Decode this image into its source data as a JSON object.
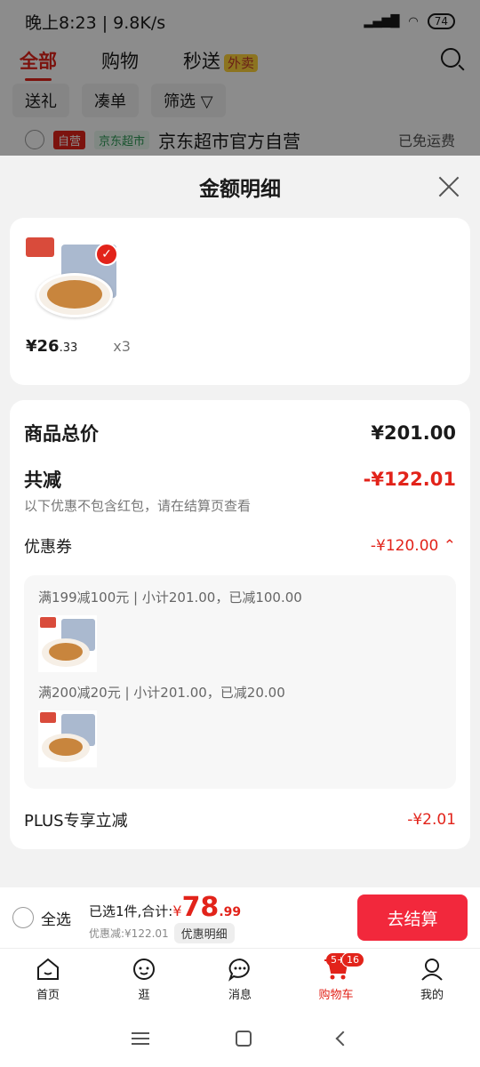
{
  "status_bar": {
    "time_speed": "晚上8:23 | 9.8K/s",
    "battery": "74"
  },
  "top_tabs": [
    {
      "label": "全部"
    },
    {
      "label": "购物"
    },
    {
      "label": "秒送",
      "badge": "外卖"
    }
  ],
  "chips": [
    "送礼",
    "凑单",
    "筛选"
  ],
  "store": {
    "tag_self": "自营",
    "tag_market": "京东超市",
    "name": "京东超市官方自营",
    "shipping": "已免运费"
  },
  "sheet": {
    "title": "金额明细",
    "product": {
      "price_int": "¥26",
      "price_dec": ".33",
      "qty": "x3"
    },
    "total_label": "商品总价",
    "total_value": "¥201.00",
    "reduce_label": "共减",
    "reduce_value": "-¥122.01",
    "reduce_note": "以下优惠不包含红包，请在结算页查看",
    "coupon_label": "优惠券",
    "coupon_value": "-¥120.00",
    "coupons": [
      {
        "text": "满199减100元 | 小计201.00，已减100.00"
      },
      {
        "text": "满200减20元 | 小计201.00，已减20.00"
      }
    ],
    "plus_label": "PLUS专享立减",
    "plus_value": "-¥2.01"
  },
  "checkout": {
    "select_all": "全选",
    "selected_text": "已选1件,合计:",
    "currency": "¥",
    "total_int": "78",
    "total_dec": ".99",
    "discount_text": "优惠减:¥122.01",
    "detail_btn": "优惠明细",
    "checkout_btn": "去结算"
  },
  "tabbar": [
    {
      "label": "首页",
      "icon": "home-icon"
    },
    {
      "label": "逛",
      "icon": "face-icon"
    },
    {
      "label": "消息",
      "icon": "message-icon",
      "badge": "5+"
    },
    {
      "label": "购物车",
      "icon": "cart-icon",
      "badge": "16",
      "active": true
    },
    {
      "label": "我的",
      "icon": "user-icon"
    }
  ],
  "colors": {
    "accent": "#e2231a",
    "checkout": "#f2283c"
  }
}
